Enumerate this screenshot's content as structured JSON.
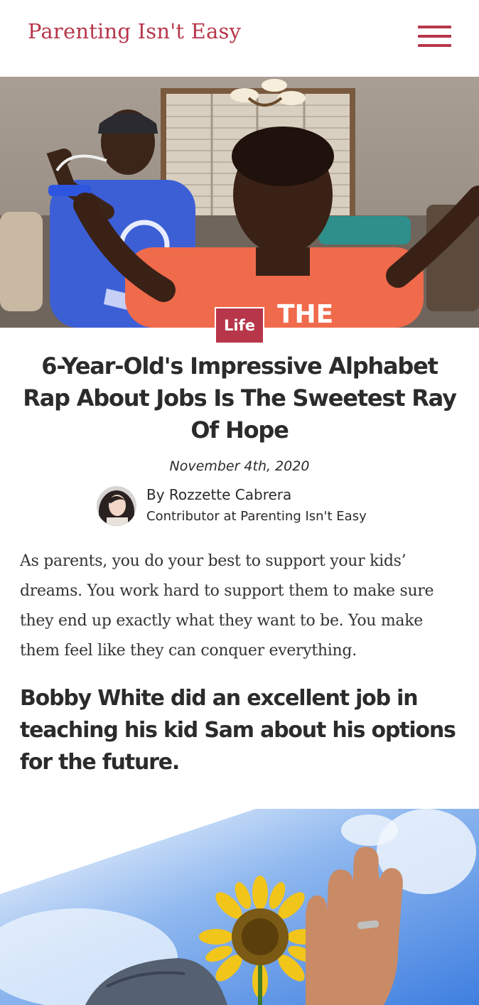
{
  "site": {
    "logo_text": "Parenting Isn't Easy",
    "brand_color": "#b8364a"
  },
  "header": {
    "menu_icon": "hamburger-menu-icon"
  },
  "article": {
    "hero_image": "photo of a boy in an orange shirt rapping beside a man in a blue shirt",
    "category": "Life",
    "title": "6-Year-Old's Impressive Alphabet Rap About Jobs Is The Sweetest Ray Of Hope",
    "date": "November 4th, 2020",
    "author": {
      "byline": "By Rozzette Cabrera",
      "role": "Contributor at Parenting Isn't Easy"
    },
    "intro": "As parents, you do your best to support your kids’ dreams. You work hard to support them to make sure they end up exactly what they want to be. You make them feel like they can conquer everything.",
    "subheading": "Bobby White did an excellent job in teaching his kid Sam about his options for the future.",
    "second_image": "photo of a sunflower and a raised hand against a blue sky"
  }
}
